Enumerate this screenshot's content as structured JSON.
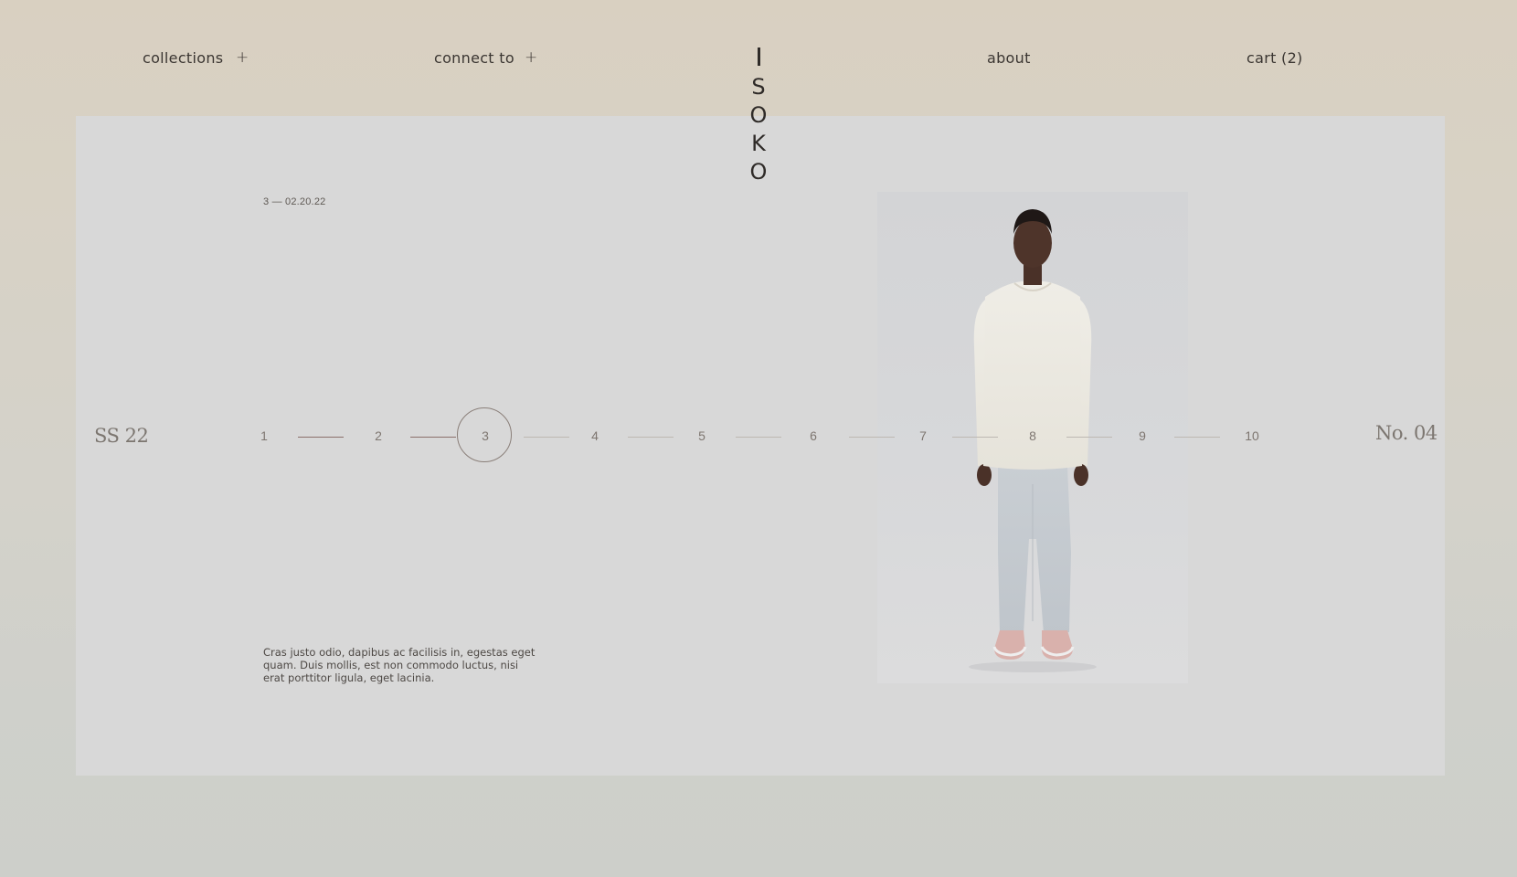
{
  "nav": {
    "collections": "collections",
    "connect": "connect to",
    "plus": "+",
    "about": "about",
    "cart": "cart (2)"
  },
  "logo": {
    "letters": [
      "S",
      "O",
      "K",
      "O"
    ]
  },
  "hero": {
    "date": "3 — 02.20.22",
    "season": "SS 22",
    "issue": "No. 04",
    "description": "Cras justo odio, dapibus ac facilisis in, egestas eget quam. Duis mollis, est non commodo luctus, nisi erat porttitor ligula, eget lacinia."
  },
  "pager": {
    "pages": [
      "1",
      "2",
      "3",
      "4",
      "5",
      "6",
      "7",
      "8",
      "9",
      "10"
    ],
    "current": "3"
  },
  "colors": {
    "background_top": "#d9d0c1",
    "background_bottom": "#cdcfca",
    "panel": "#d8d8d8",
    "text": "#3b3632",
    "accent_line": "#8a6f6a"
  }
}
